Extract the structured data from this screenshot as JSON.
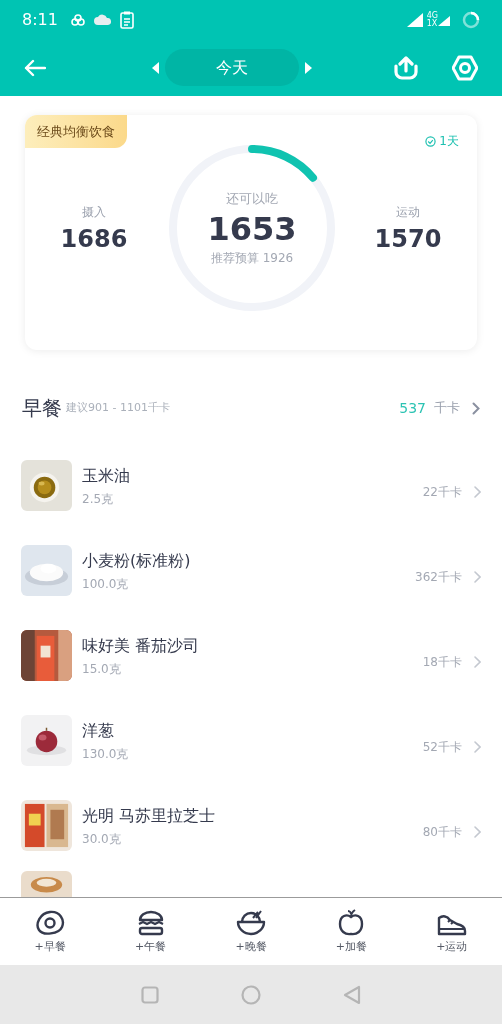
{
  "status_bar": {
    "time": "8:11",
    "network": "4G",
    "network_sub": "1X"
  },
  "header": {
    "date": "今天"
  },
  "summary": {
    "diet_tag": "经典均衡饮食",
    "streak": "1天",
    "intake_label": "摄入",
    "intake": "1686",
    "remaining_label": "还可以吃",
    "remaining": "1653",
    "budget": "推荐预算 1926",
    "level": 0.14,
    "exercise_label": "运动",
    "exercise": "1570"
  },
  "meal": {
    "title": "早餐",
    "suggestion": "建议901 - 1101千卡",
    "total": "537",
    "unit": "千卡",
    "items": [
      {
        "name": "玉米油",
        "amount": "2.5克",
        "calories": "22千卡"
      },
      {
        "name": "小麦粉(标准粉)",
        "amount": "100.0克",
        "calories": "362千卡"
      },
      {
        "name": "味好美 番茄沙司",
        "amount": "15.0克",
        "calories": "18千卡"
      },
      {
        "name": "洋葱",
        "amount": "130.0克",
        "calories": "52千卡"
      },
      {
        "name": "光明 马苏里拉芝士",
        "amount": "30.0克",
        "calories": "80千卡"
      }
    ]
  },
  "bottom_tabs": [
    "+早餐",
    "+午餐",
    "+晚餐",
    "+加餐",
    "+运动"
  ]
}
